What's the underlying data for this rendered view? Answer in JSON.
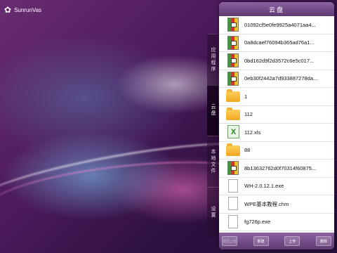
{
  "app": {
    "logo_text": "SunrunVas",
    "logo_icon": "flower-logo-icon"
  },
  "side_tabs": [
    {
      "label": "应用程序",
      "active": false
    },
    {
      "label": "云盘",
      "active": true
    },
    {
      "label": "本地文件",
      "active": false
    },
    {
      "label": "设置",
      "active": false
    }
  ],
  "panel": {
    "title": "云盘",
    "files": [
      {
        "name": "01092cf5e0fe9925a4071aa4...",
        "icon": "archive-icon"
      },
      {
        "name": "0a8dcaef76094b365ad76a1...",
        "icon": "archive-icon"
      },
      {
        "name": "0bd162d9f2d3572c6e5c017...",
        "icon": "archive-icon"
      },
      {
        "name": "0eb30f2442a7d933887278da...",
        "icon": "archive-icon"
      },
      {
        "name": "1",
        "icon": "folder-icon"
      },
      {
        "name": "112",
        "icon": "folder-icon"
      },
      {
        "name": "112.xls",
        "icon": "excel-icon"
      },
      {
        "name": "88",
        "icon": "folder-icon"
      },
      {
        "name": "8b13632762d0f70314f60875...",
        "icon": "archive-icon"
      },
      {
        "name": "WH-2.0.12.1.exe",
        "icon": "document-icon"
      },
      {
        "name": "WPE基本教程.chm",
        "icon": "document-icon"
      },
      {
        "name": "fg726p.exe",
        "icon": "document-icon"
      }
    ],
    "toolbar": {
      "btn1": "返回上级",
      "btn2": "新建",
      "btn3": "上传",
      "btn4": "删除"
    }
  }
}
